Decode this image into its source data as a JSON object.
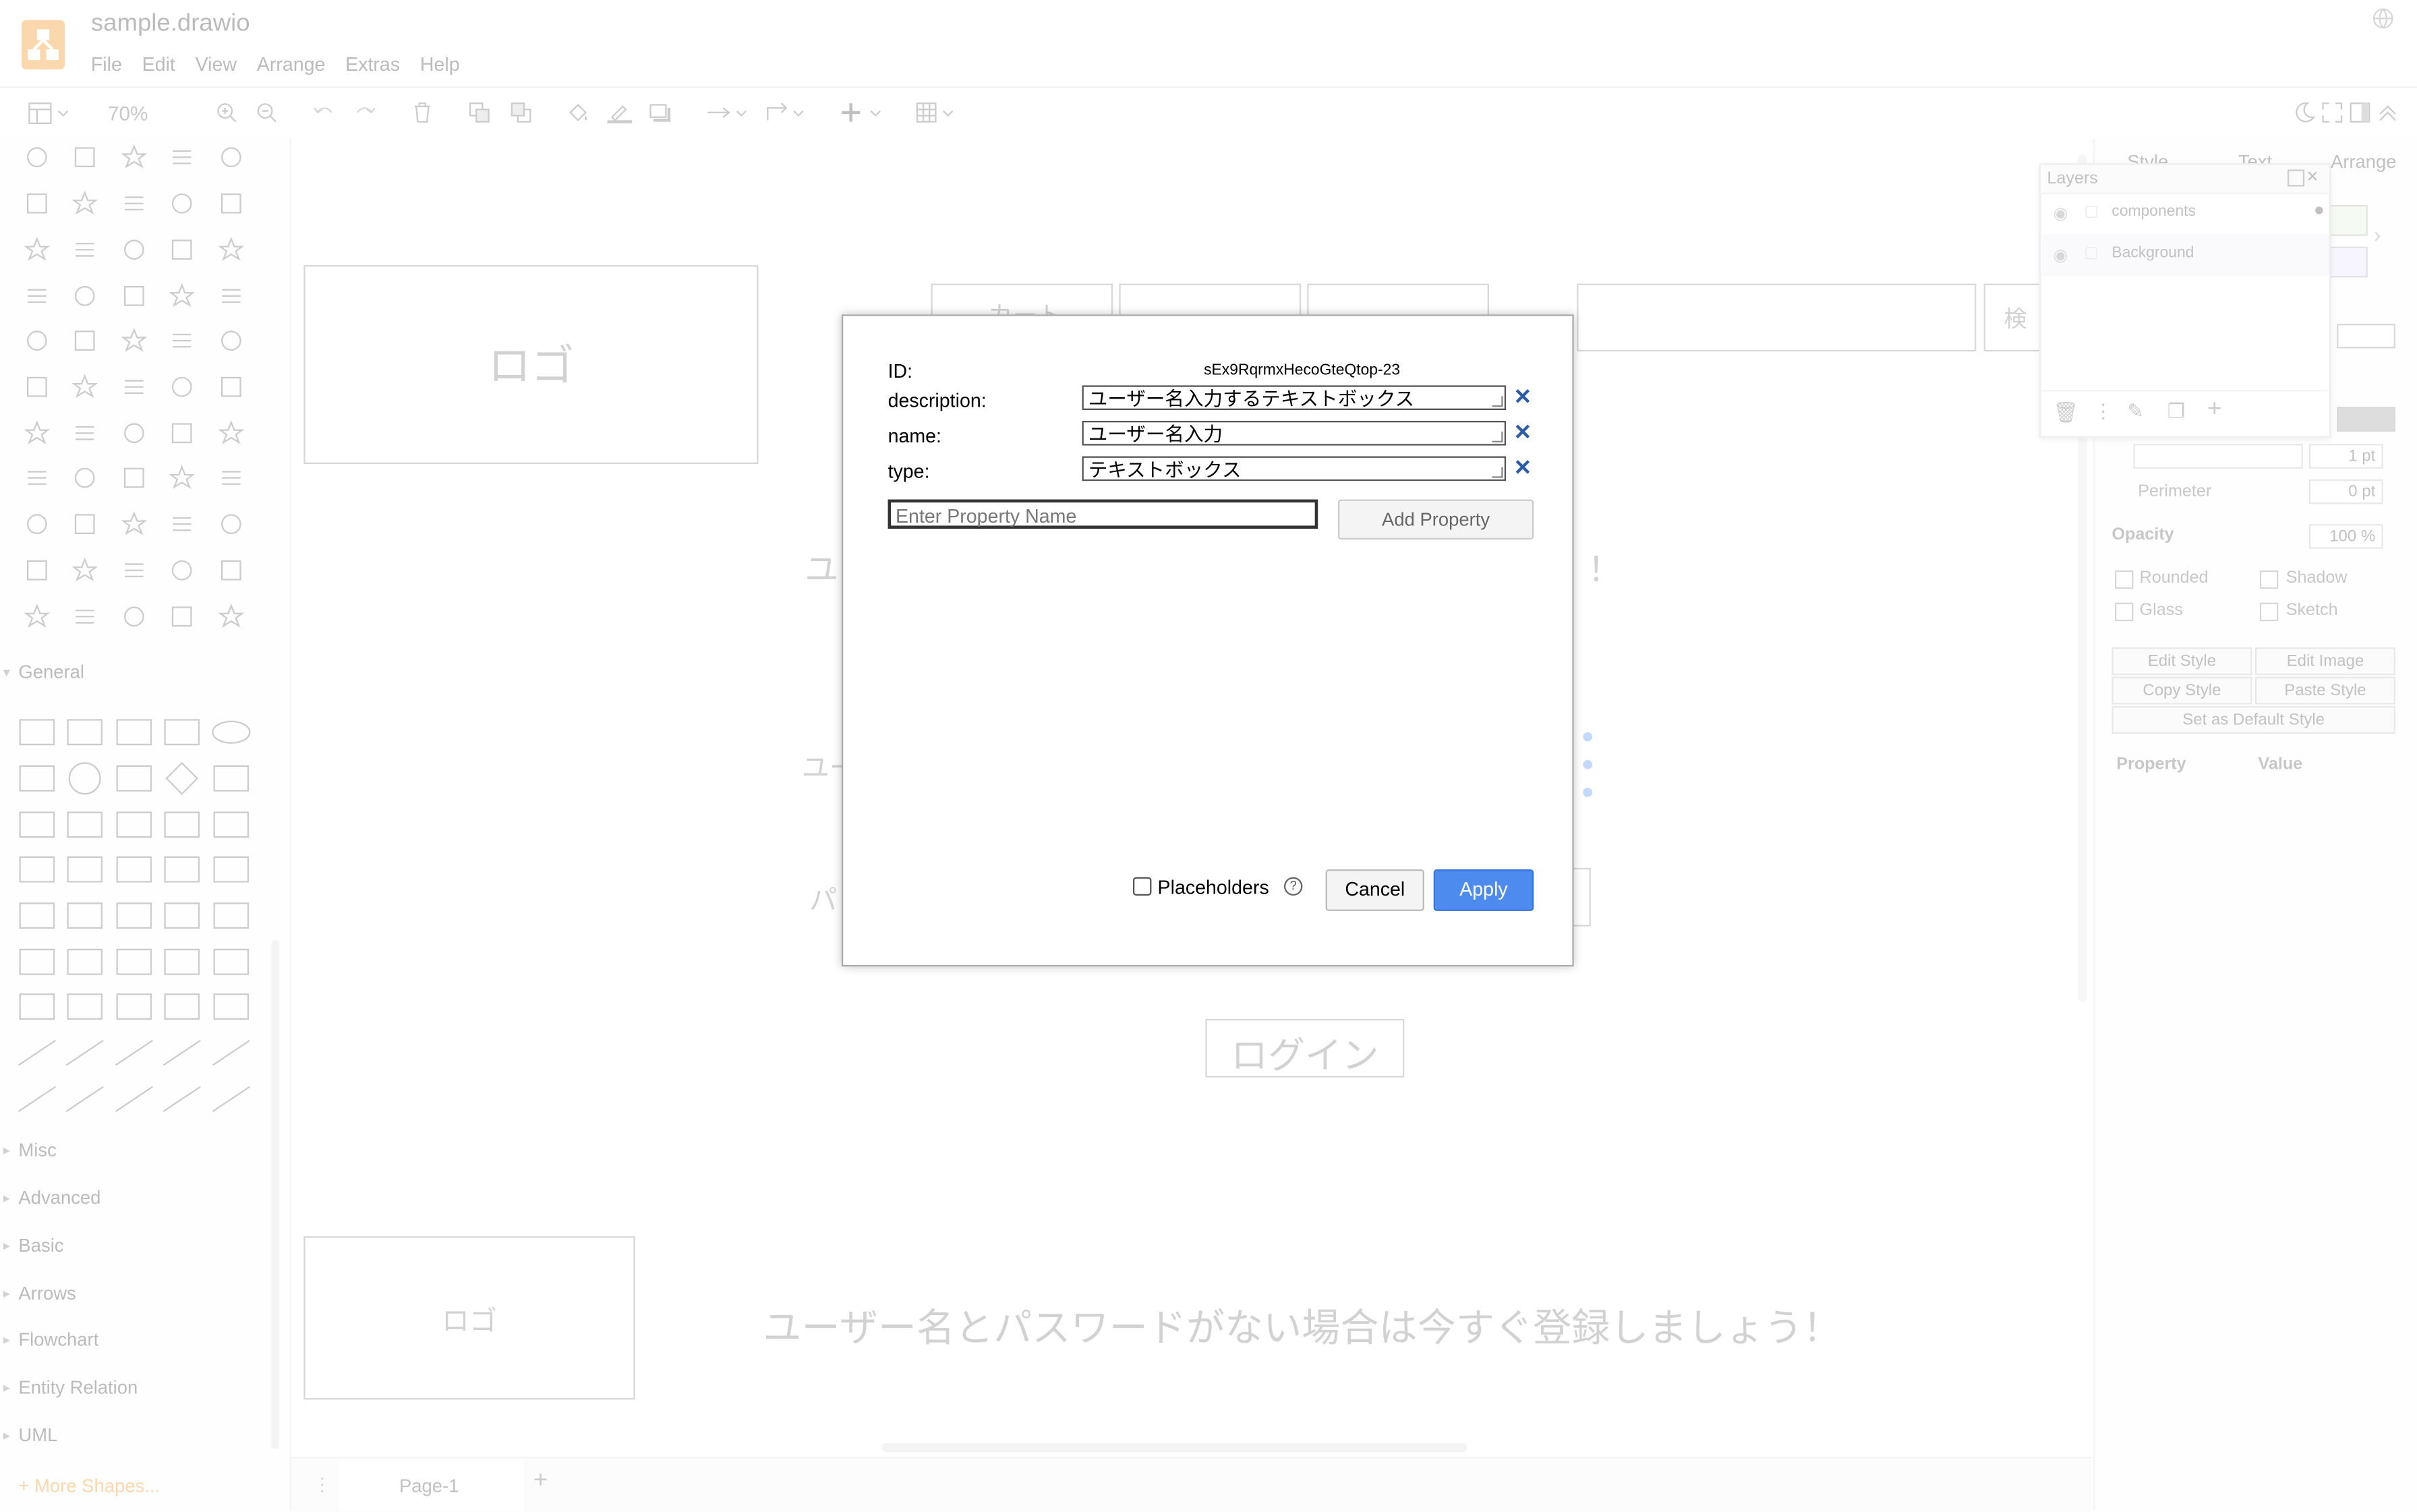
{
  "app": {
    "title": "sample.drawio",
    "menu": [
      "File",
      "Edit",
      "View",
      "Arrange",
      "Extras",
      "Help"
    ]
  },
  "toolbar": {
    "zoom": "70%"
  },
  "sidebar": {
    "sections": [
      "General",
      "Misc",
      "Advanced",
      "Basic",
      "Arrows",
      "Flowchart",
      "Entity Relation",
      "UML"
    ],
    "more_shapes": "+ More Shapes..."
  },
  "canvas": {
    "logo_top": "ロゴ",
    "cart_fragment": "カート",
    "search_fragment": "検",
    "u_fragment1": "ユ",
    "u_fragment2": "ユー",
    "pa_fragment": "パ",
    "exclaim": "！",
    "login": "ログイン",
    "logo_bottom": "ロゴ",
    "register_msg": "ユーザー名とパスワードがない場合は今すぐ登録しましょう！"
  },
  "right_panel": {
    "tabs": [
      "Style",
      "Text",
      "Arrange"
    ],
    "line_width": "1 pt",
    "perimeter_label": "Perimeter",
    "perimeter_value": "0 pt",
    "opacity_label": "Opacity",
    "opacity_value": "100 %",
    "rounded": "Rounded",
    "shadow": "Shadow",
    "glass": "Glass",
    "sketch": "Sketch",
    "edit_style": "Edit Style",
    "edit_image": "Edit Image",
    "copy_style": "Copy Style",
    "paste_style": "Paste Style",
    "set_default": "Set as Default Style",
    "prop_col": "Property",
    "value_col": "Value"
  },
  "layers": {
    "title": "Layers",
    "items": [
      "components",
      "Background"
    ]
  },
  "page_tab": {
    "name": "Page-1"
  },
  "dialog": {
    "id_label": "ID:",
    "id_value": "sEx9RqrmxHecoGteQtop-23",
    "fields": [
      {
        "label": "description:",
        "value": "ユーザー名入力するテキストボックス"
      },
      {
        "label": "name:",
        "value": "ユーザー名入力"
      },
      {
        "label": "type:",
        "value": "テキストボックス"
      }
    ],
    "property_placeholder": "Enter Property Name",
    "add_property": "Add Property",
    "placeholders_label": "Placeholders",
    "cancel": "Cancel",
    "apply": "Apply"
  },
  "colors": {
    "accent": "#4d8bef",
    "logo": "#f08705"
  }
}
